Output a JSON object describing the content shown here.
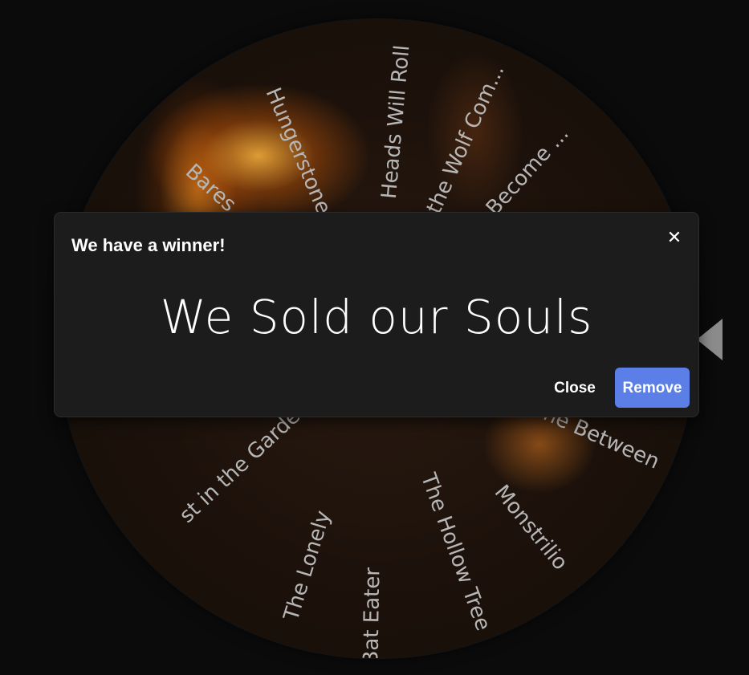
{
  "wheel": {
    "slices": [
      "Heads Will Roll",
      "the Wolf Com...",
      "k I Become ...",
      "he Between",
      "Monstrilio",
      "The Hollow Tree",
      "Bat Eater",
      "The Lonely",
      "st in the Garden",
      "Bares ...",
      "Hungerstone"
    ]
  },
  "dialog": {
    "title": "We have a winner!",
    "close_icon": "close-icon",
    "winner": "We Sold our Souls",
    "close_label": "Close",
    "remove_label": "Remove"
  },
  "colors": {
    "background": "#0b0b0b",
    "dialog_bg": "#1c1c1c",
    "remove_button": "#5b7fe6",
    "pointer": "#8b8b8b",
    "wheel_label": "#b6b6b6"
  }
}
